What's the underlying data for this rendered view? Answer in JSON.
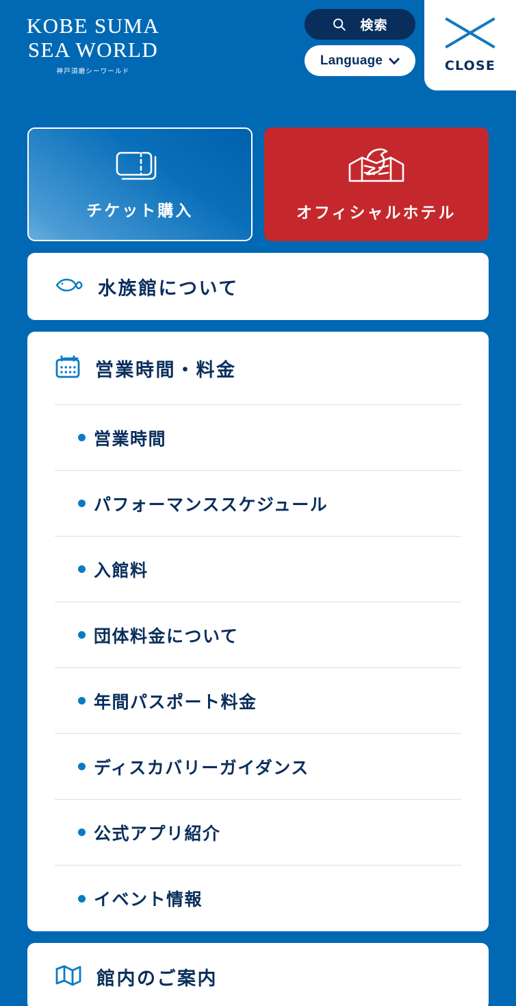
{
  "header": {
    "logo": {
      "line1": "KOBE SUMA",
      "line2": "SEA WORLD",
      "subtitle": "神戸須磨シーワールド"
    },
    "search": {
      "label": "検索",
      "icon": "search-icon"
    },
    "language": {
      "label": "Language",
      "icon": "chevron-down-icon"
    },
    "close": {
      "label": "CLOSE",
      "icon": "close-x-icon"
    },
    "colors": {
      "background": "#0168b4",
      "navy": "#0a2e5c",
      "white": "#ffffff",
      "accent_blue": "#0a7ac4",
      "hotel_red": "#c4282d",
      "divider": "#cfe4f2"
    }
  },
  "top_buttons": [
    {
      "label": "チケット購入",
      "icon": "ticket-icon",
      "style": "gradient-blue"
    },
    {
      "label": "オフィシャルホテル",
      "icon": "dolphin-hotel-icon",
      "style": "red"
    }
  ],
  "sections": [
    {
      "title": "水族館について",
      "icon": "fish-icon",
      "items": []
    },
    {
      "title": "営業時間・料金",
      "icon": "calendar-icon",
      "items": [
        {
          "label": "営業時間"
        },
        {
          "label": "パフォーマンススケジュール"
        },
        {
          "label": "入館料"
        },
        {
          "label": "団体料金について"
        },
        {
          "label": "年間パスポート料金"
        },
        {
          "label": "ディスカバリーガイダンス"
        },
        {
          "label": "公式アプリ紹介"
        },
        {
          "label": "イベント情報"
        }
      ]
    },
    {
      "title": "館内のご案内",
      "icon": "map-icon",
      "items": []
    }
  ]
}
